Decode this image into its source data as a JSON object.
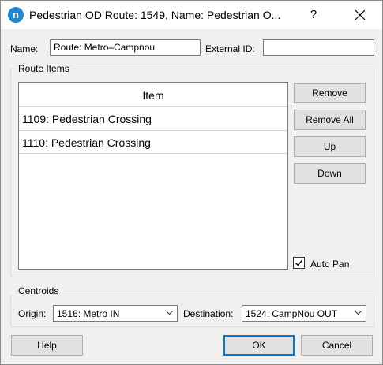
{
  "window": {
    "title": "Pedestrian OD Route: 1549, Name: Pedestrian O...",
    "app_icon_letter": "n",
    "help_glyph": "?",
    "close_glyph": "✕"
  },
  "form": {
    "name_label": "Name:",
    "name_value": "Route: Metro–Campnou",
    "external_id_label": "External ID:",
    "external_id_value": ""
  },
  "route_items": {
    "group_title": "Route Items",
    "column_header": "Item",
    "items": [
      "1109: Pedestrian Crossing",
      "1110: Pedestrian Crossing"
    ],
    "buttons": {
      "remove": "Remove",
      "remove_all": "Remove All",
      "up": "Up",
      "down": "Down"
    },
    "auto_pan_label": "Auto Pan",
    "auto_pan_checked": true
  },
  "centroids": {
    "group_title": "Centroids",
    "origin_label": "Origin:",
    "origin_value": "1516: Metro IN",
    "destination_label": "Destination:",
    "destination_value": "1524: CampNou OUT"
  },
  "footer": {
    "help": "Help",
    "ok": "OK",
    "cancel": "Cancel"
  },
  "colors": {
    "accent": "#0078d7",
    "app_icon": "#1f86d2",
    "dialog_bg": "#f0f0f0"
  }
}
